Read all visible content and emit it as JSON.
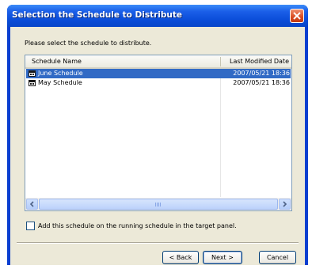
{
  "window": {
    "title": "Selection the Schedule to Distribute"
  },
  "prompt": "Please select the schedule to distribute.",
  "list": {
    "columns": {
      "name": "Schedule Name",
      "date": "Last Modified Date"
    },
    "rows": [
      {
        "name": "June Schedule",
        "date": "2007/05/21 18:36",
        "selected": true,
        "icon": "schedule-icon"
      },
      {
        "name": "May Schedule",
        "date": "2007/05/21 18:36",
        "selected": false,
        "icon": "schedule-icon"
      }
    ]
  },
  "checkbox": {
    "label": "Add this schedule on the running schedule in the target panel.",
    "checked": false
  },
  "buttons": {
    "back": "< Back",
    "next": "Next >",
    "cancel": "Cancel"
  },
  "colors": {
    "titlebar": "#0a4cd8",
    "selection": "#316ac5",
    "dialog_bg": "#ece9d8"
  }
}
